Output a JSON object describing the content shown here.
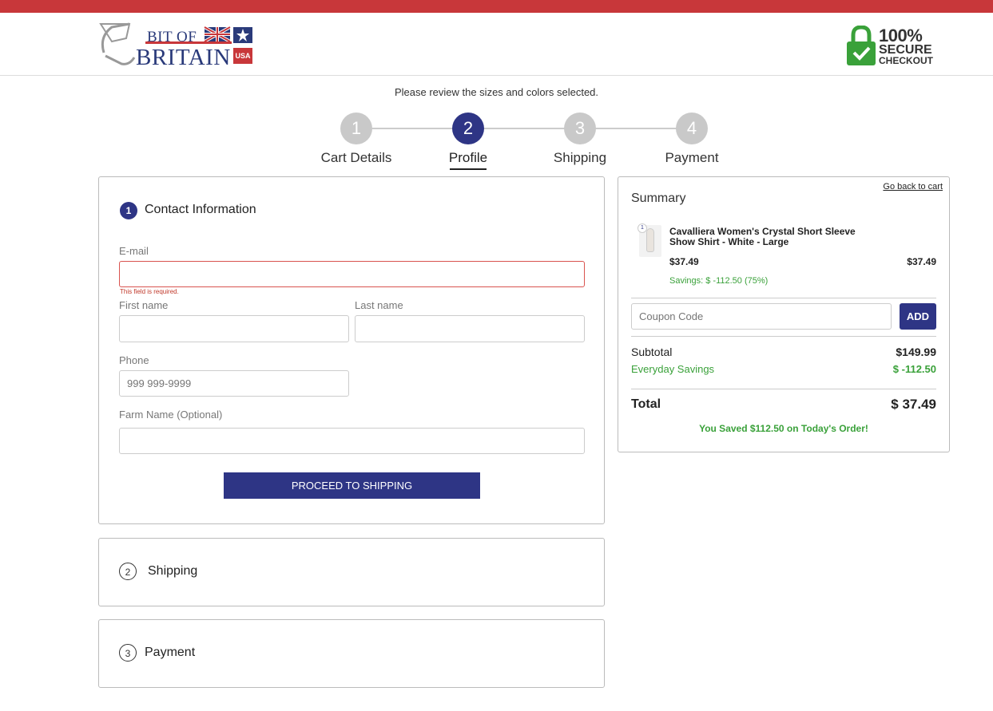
{
  "brand": {
    "logo_line1": "BIT OF",
    "logo_line2": "BRITAIN",
    "logo_badge": "USA",
    "secure_line1": "100%",
    "secure_line2": "SECURE",
    "secure_line3": "CHECKOUT",
    "accent": "#2e3585",
    "red": "#c8373a",
    "green": "#3aa13a"
  },
  "review_notice": "Please review the sizes and colors selected.",
  "steps": [
    {
      "num": "1",
      "label": "Cart Details",
      "active": false
    },
    {
      "num": "2",
      "label": "Profile",
      "active": true
    },
    {
      "num": "3",
      "label": "Shipping",
      "active": false
    },
    {
      "num": "4",
      "label": "Payment",
      "active": false
    }
  ],
  "contact": {
    "num": "1",
    "title": "Contact Information",
    "email_label": "E-mail",
    "email_value": "",
    "email_error": "This field is required.",
    "first_name_label": "First name",
    "first_name_value": "",
    "last_name_label": "Last name",
    "last_name_value": "",
    "phone_label": "Phone",
    "phone_placeholder": "999 999-9999",
    "farm_label": "Farm Name (Optional)",
    "farm_value": "",
    "proceed_label": "PROCEED TO SHIPPING"
  },
  "shipping_section": {
    "num": "2",
    "title": "Shipping"
  },
  "payment_section": {
    "num": "3",
    "title": "Payment"
  },
  "summary": {
    "title": "Summary",
    "back_link": "Go back to cart",
    "item": {
      "qty": "1",
      "name": "Cavalliera Women's Crystal Short Sleeve Show Shirt - White - Large",
      "unit_price": "$37.49",
      "line_total": "$37.49",
      "savings": "Savings:  $ -112.50 (75%)"
    },
    "coupon_placeholder": "Coupon Code",
    "add_label": "ADD",
    "subtotal_label": "Subtotal",
    "subtotal_value": "$149.99",
    "savings_label": "Everyday Savings",
    "savings_value": "$ -112.50",
    "total_label": "Total",
    "total_value": "$ 37.49",
    "saved_message": "You Saved $112.50 on Today's Order!"
  },
  "icons": {
    "logo": "horseshoe-flag-logo",
    "secure": "padlock-check-icon"
  }
}
